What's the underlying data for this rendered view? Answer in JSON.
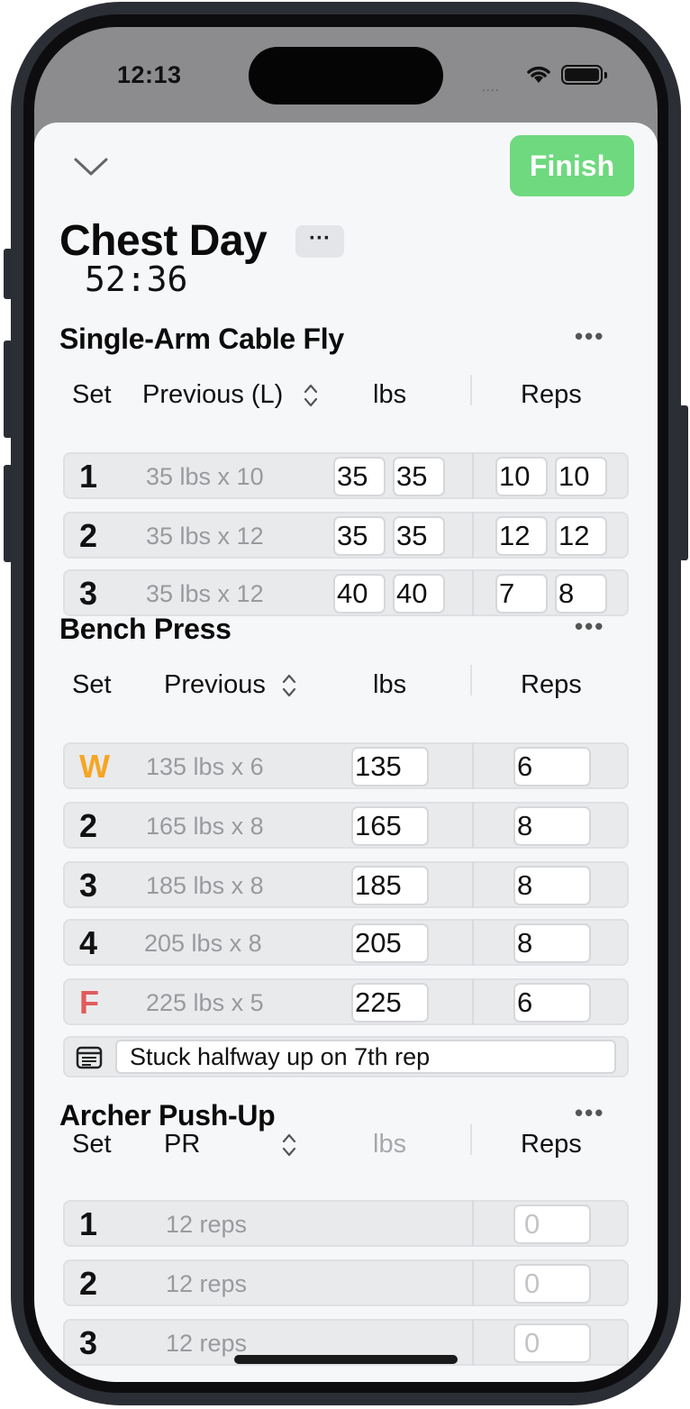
{
  "status_bar": {
    "time": "12:13",
    "signal": "....",
    "wifi_icon": "wifi-icon",
    "battery_icon": "battery-icon"
  },
  "header": {
    "collapse_icon": "chevron-down-icon",
    "finish_label": "Finish",
    "finish_color": "#6ed97e"
  },
  "workout": {
    "title": "Chest Day",
    "more_label": "···",
    "timer": "52:36"
  },
  "exercises": [
    {
      "name": "Single-Arm Cable Fly",
      "more": "•••",
      "columns": {
        "set": "Set",
        "previous": "Previous (L)",
        "weight": "lbs",
        "reps": "Reps"
      },
      "sets": [
        {
          "label": "1",
          "previous": "35 lbs x 10",
          "weight_l": "35",
          "weight_r": "35",
          "reps_l": "10",
          "reps_r": "10"
        },
        {
          "label": "2",
          "previous": "35 lbs x 12",
          "weight_l": "35",
          "weight_r": "35",
          "reps_l": "12",
          "reps_r": "12"
        },
        {
          "label": "3",
          "previous": "35 lbs x 12",
          "weight_l": "40",
          "weight_r": "40",
          "reps_l": "7",
          "reps_r": "8"
        }
      ]
    },
    {
      "name": "Bench Press",
      "more": "•••",
      "columns": {
        "set": "Set",
        "previous": "Previous",
        "weight": "lbs",
        "reps": "Reps"
      },
      "sets": [
        {
          "label": "W",
          "type": "warmup",
          "type_color": "#f5a623",
          "previous": "135 lbs x 6",
          "weight": "135",
          "reps": "6"
        },
        {
          "label": "2",
          "previous": "165 lbs x 8",
          "weight": "165",
          "reps": "8"
        },
        {
          "label": "3",
          "previous": "185 lbs x 8",
          "weight": "185",
          "reps": "8"
        },
        {
          "label": "4",
          "previous": "205 lbs x 8",
          "weight": "205",
          "reps": "8"
        },
        {
          "label": "F",
          "type": "failure",
          "type_color": "#e05c5c",
          "previous": "225 lbs x 5",
          "weight": "225",
          "reps": "6"
        }
      ],
      "note": {
        "icon": "note-icon",
        "text": "Stuck halfway up on 7th rep"
      }
    },
    {
      "name": "Archer Push-Up",
      "more": "•••",
      "columns": {
        "set": "Set",
        "previous": "PR",
        "weight": "lbs",
        "reps": "Reps"
      },
      "sets": [
        {
          "label": "1",
          "previous": "12 reps",
          "reps_placeholder": "0"
        },
        {
          "label": "2",
          "previous": "12 reps",
          "reps_placeholder": "0"
        },
        {
          "label": "3",
          "previous": "12 reps",
          "reps_placeholder": "0"
        }
      ]
    }
  ]
}
